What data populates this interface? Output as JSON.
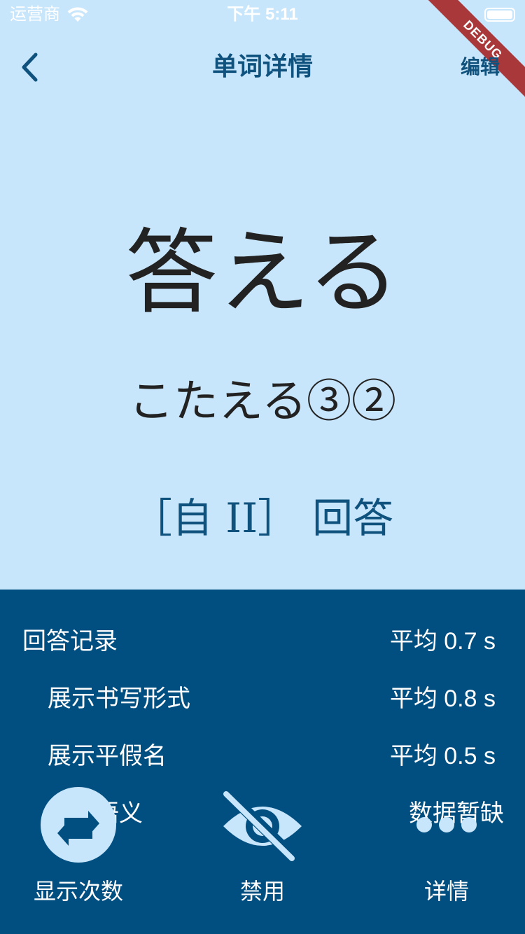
{
  "status_bar": {
    "carrier": "运营商",
    "time": "下午 5:11"
  },
  "debug_banner": "DEBUG",
  "nav": {
    "title": "单词详情",
    "edit_label": "编辑"
  },
  "word": {
    "writing": "答える",
    "reading": "こたえる③②",
    "part_of_speech": "［自 II］",
    "meaning": "回答"
  },
  "stats": [
    {
      "label": "回答记录",
      "value": "平均 0.7 s"
    },
    {
      "label": "展示书写形式",
      "value": "平均 0.8 s"
    },
    {
      "label": "展示平假名",
      "value": "平均 0.5 s"
    },
    {
      "label": "展示语义",
      "value": "数据暂缺"
    }
  ],
  "actions": [
    {
      "label": "显示次数",
      "icon": "swap-arrows-icon"
    },
    {
      "label": "禁用",
      "icon": "eye-off-icon"
    },
    {
      "label": "详情",
      "icon": "more-dots-icon"
    }
  ],
  "colors": {
    "background": "#c8e6fb",
    "panel": "#004f80",
    "accent": "#10527e",
    "debug": "#a8383a"
  }
}
